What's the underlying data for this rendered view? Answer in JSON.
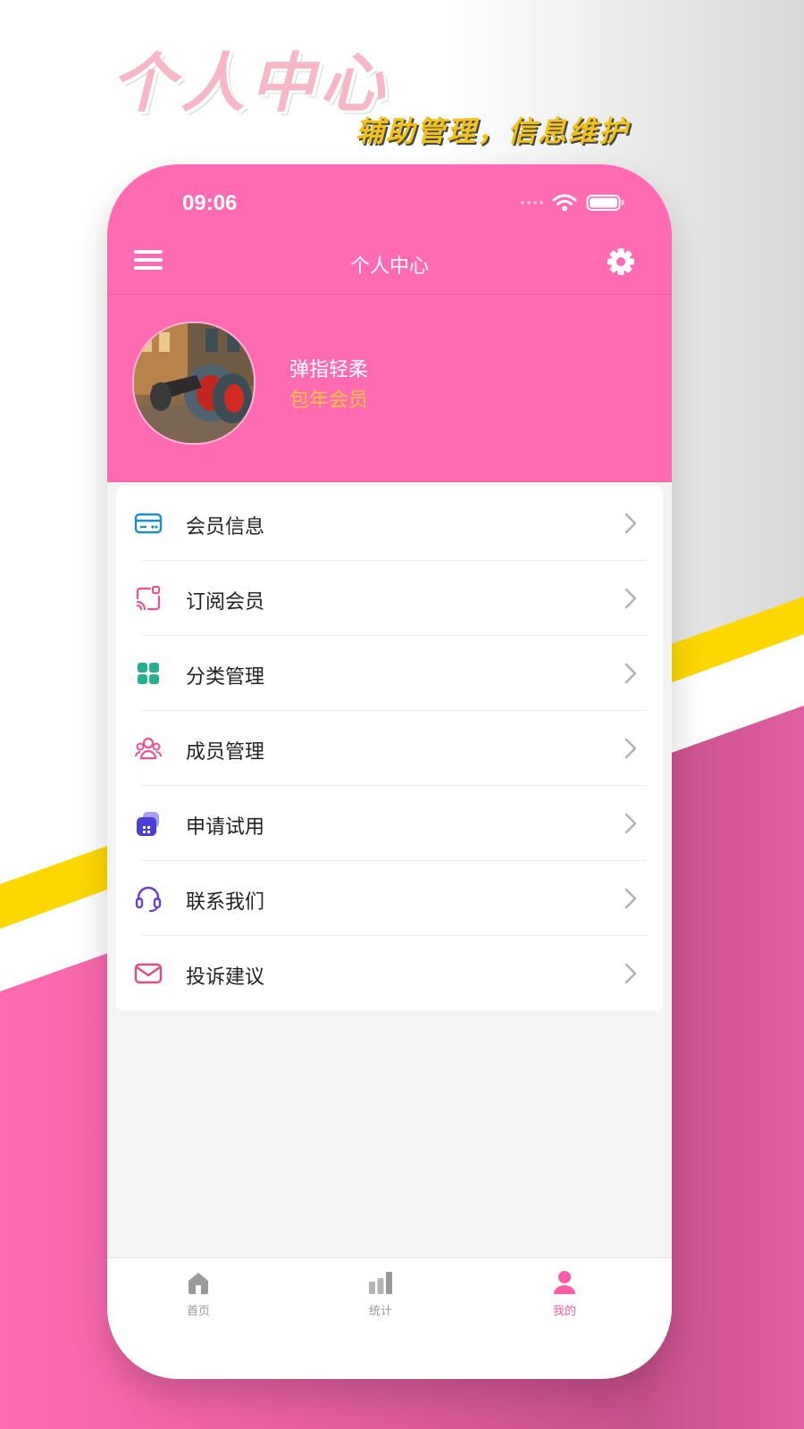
{
  "promo": {
    "title": "个人中心",
    "subtitle": "辅助管理，信息维护"
  },
  "colors": {
    "brand_pink": "#ff6bb2",
    "member_gold": "#ffc53d",
    "active_tab": "#ff5aa8",
    "promo_yellow": "#f2c21b"
  },
  "status_bar": {
    "time": "09:06"
  },
  "navbar": {
    "title": "个人中心",
    "left_icon": "menu-icon",
    "right_icon": "gear-icon"
  },
  "profile": {
    "name": "弹指轻柔",
    "tier": "包年会员",
    "avatar_icon": "motorcycle-avatar"
  },
  "menu": {
    "items": [
      {
        "label": "会员信息",
        "icon": "membership-card-icon"
      },
      {
        "label": "订阅会员",
        "icon": "subscription-icon"
      },
      {
        "label": "分类管理",
        "icon": "category-grid-icon"
      },
      {
        "label": "成员管理",
        "icon": "members-icon"
      },
      {
        "label": "申请试用",
        "icon": "trial-apply-icon"
      },
      {
        "label": "联系我们",
        "icon": "headset-icon"
      },
      {
        "label": "投诉建议",
        "icon": "mail-icon"
      }
    ]
  },
  "tabbar": {
    "items": [
      {
        "label": "首页",
        "icon": "home-icon"
      },
      {
        "label": "统计",
        "icon": "bar-chart-icon"
      },
      {
        "label": "我的",
        "icon": "user-icon",
        "active": true
      }
    ]
  }
}
